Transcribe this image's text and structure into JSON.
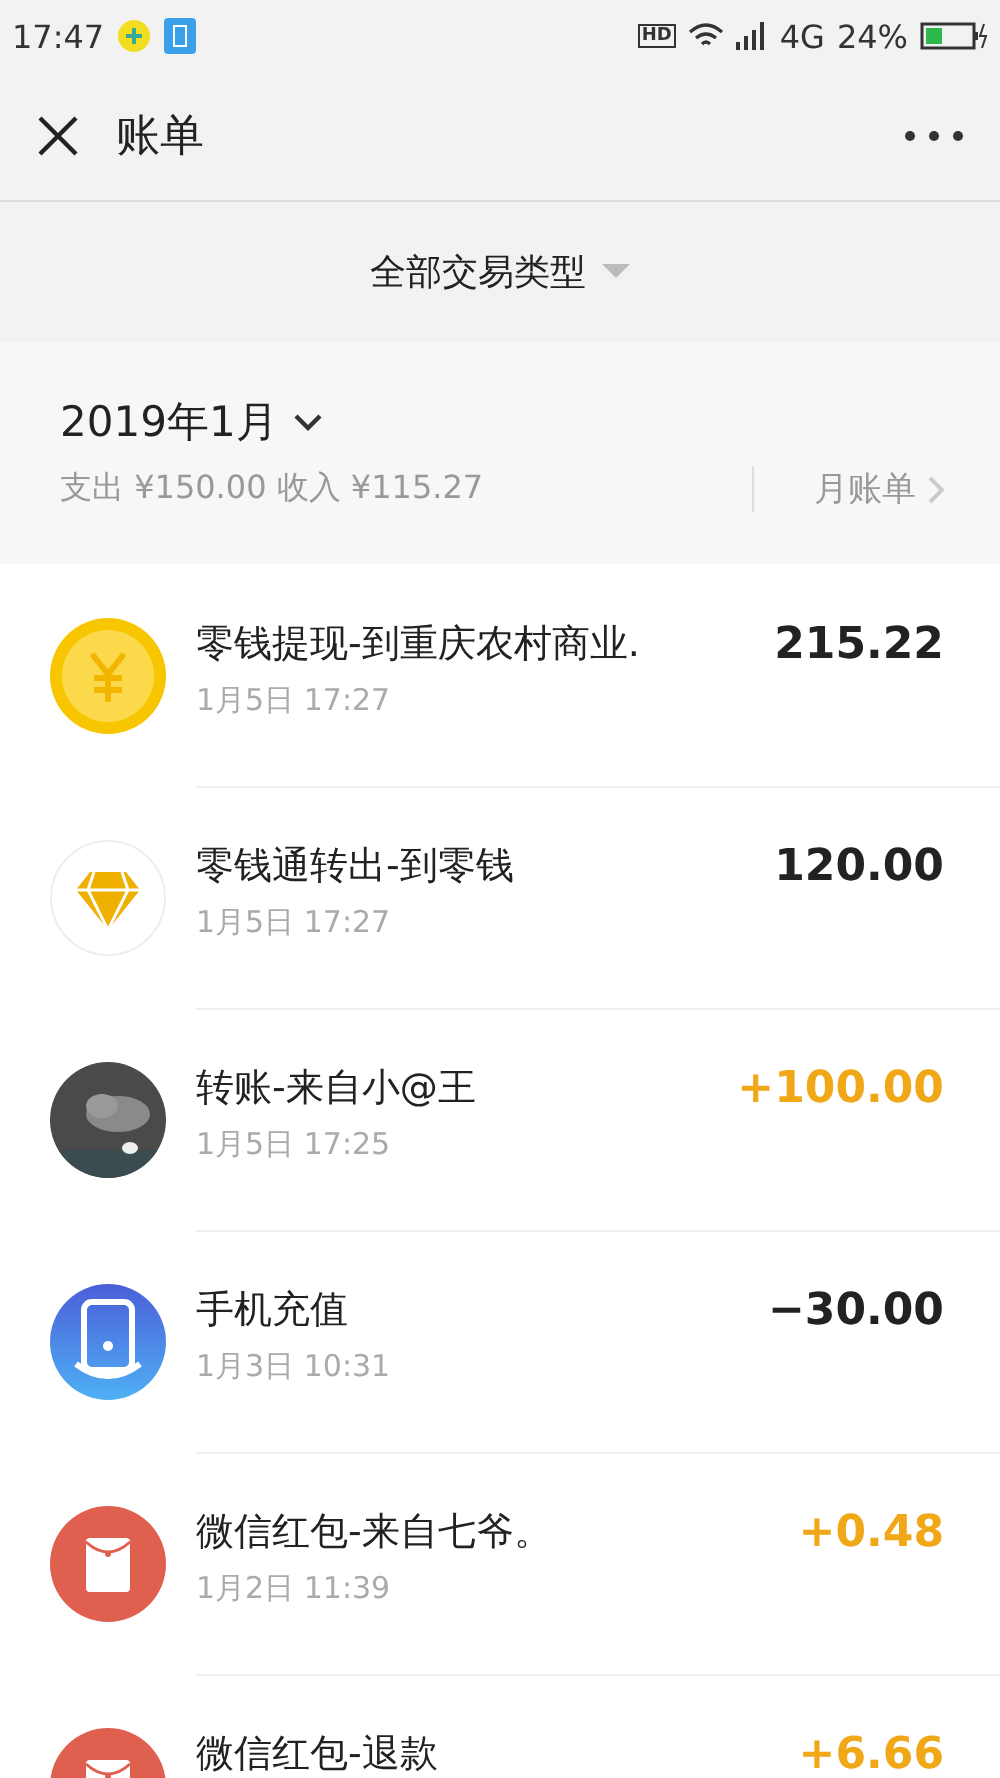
{
  "status_bar": {
    "time": "17:47",
    "hd": "HD",
    "network": "4G",
    "battery": "24%"
  },
  "header": {
    "title": "账单"
  },
  "filter": {
    "label": "全部交易类型"
  },
  "month": {
    "title": "2019年1月",
    "summary": "支出 ¥150.00 收入 ¥115.27",
    "monthly_bill": "月账单"
  },
  "transactions": [
    {
      "kind": "coin",
      "title": "零钱提现-到重庆农村商业.",
      "time": "1月5日 17:27",
      "amount": "215.22",
      "income": false
    },
    {
      "kind": "diamond",
      "title": "零钱通转出-到零钱",
      "time": "1月5日 17:27",
      "amount": "120.00",
      "income": false
    },
    {
      "kind": "picture",
      "title": "转账-来自小@王",
      "time": "1月5日 17:25",
      "amount": "+100.00",
      "income": true
    },
    {
      "kind": "phone",
      "title": "手机充值",
      "time": "1月3日 10:31",
      "amount": "−30.00",
      "income": false
    },
    {
      "kind": "redpacket",
      "title": "微信红包-来自七爷。",
      "time": "1月2日 11:39",
      "amount": "+0.48",
      "income": true
    },
    {
      "kind": "redpacket",
      "title": "微信红包-退款",
      "amount": "+6.66",
      "income": true
    }
  ]
}
